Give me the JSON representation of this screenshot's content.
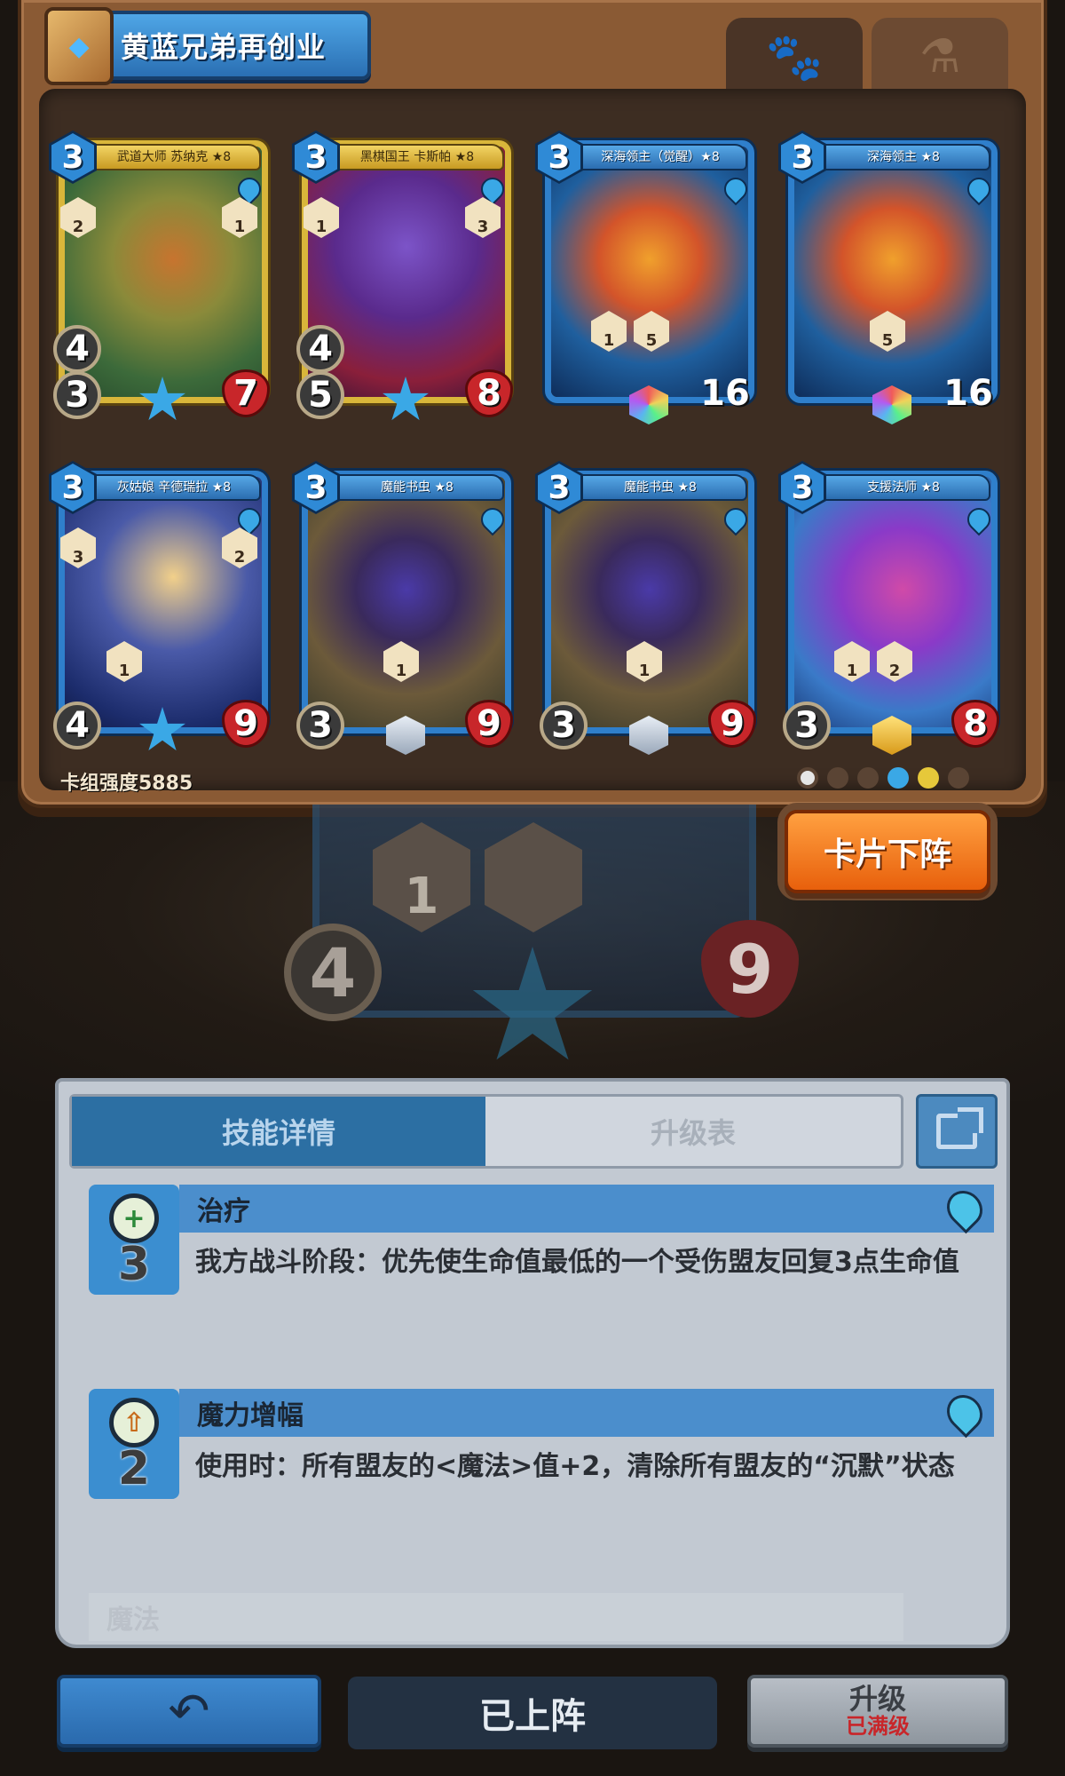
{
  "deck": {
    "title": "黄蓝兄弟再创业",
    "tabs": [
      {
        "icon": "paw-icon",
        "active": true
      },
      {
        "icon": "potion-icon",
        "active": false
      }
    ],
    "strength_label": "卡组强度5885",
    "filters": [
      "all",
      "beast",
      "fire",
      "water",
      "wind",
      "flame"
    ]
  },
  "cards": [
    {
      "name": "武道大师 苏纳克 ★8",
      "cost": "3",
      "atk": "3",
      "atk2": "4",
      "hp": "7",
      "skills": [
        "2",
        "1"
      ],
      "bottom_skill": "",
      "gem": "star",
      "frame": "gold",
      "art": "monk"
    },
    {
      "name": "黑棋国王 卡斯帕 ★8",
      "cost": "3",
      "atk": "5",
      "atk2": "4",
      "hp": "8",
      "skills": [
        "1",
        "3"
      ],
      "bottom_skill": "",
      "gem": "star",
      "frame": "gold",
      "art": "king"
    },
    {
      "name": "深海领主（觉醒）★8",
      "cost": "3",
      "atk": "",
      "atk2": "",
      "hp": "16",
      "skills": [
        "1",
        "5"
      ],
      "bottom_skill": "",
      "gem": "rainbow",
      "frame": "blue",
      "art": "kraken"
    },
    {
      "name": "深海领主 ★8",
      "cost": "3",
      "atk": "",
      "atk2": "",
      "hp": "16",
      "skills": [
        "5"
      ],
      "bottom_skill": "",
      "gem": "rainbow",
      "frame": "blue",
      "art": "kraken"
    },
    {
      "name": "灰姑娘 辛德瑞拉 ★8",
      "cost": "3",
      "atk": "4",
      "atk2": "",
      "hp": "9",
      "skills": [
        "3",
        "2",
        "1"
      ],
      "bottom_skill": "",
      "gem": "star",
      "frame": "blue",
      "art": "cinder"
    },
    {
      "name": "魔能书虫 ★8",
      "cost": "3",
      "atk": "3",
      "atk2": "",
      "hp": "9",
      "skills": [
        "1"
      ],
      "bottom_skill": "",
      "gem": "silver",
      "frame": "blue",
      "art": "worm"
    },
    {
      "name": "魔能书虫 ★8",
      "cost": "3",
      "atk": "3",
      "atk2": "",
      "hp": "9",
      "skills": [
        "1"
      ],
      "bottom_skill": "",
      "gem": "silver",
      "frame": "blue",
      "art": "worm"
    },
    {
      "name": "支援法师 ★8",
      "cost": "3",
      "atk": "3",
      "atk2": "",
      "hp": "8",
      "skills": [
        "1",
        "2"
      ],
      "bottom_skill": "",
      "gem": "gold",
      "frame": "blue",
      "art": "mage"
    }
  ],
  "preview": {
    "skill_1": "1",
    "atk": "4",
    "hp": "9"
  },
  "actions": {
    "unequip_label": "卡片下阵"
  },
  "skill_panel": {
    "tab_active": "技能详情",
    "tab_inactive": "升级表",
    "skills": [
      {
        "name": "治疗",
        "level": "3",
        "glyph": "+",
        "desc": "我方战斗阶段：优先使生命值最低的一个受伤盟友回复3点生命值"
      },
      {
        "name": "魔力增幅",
        "level": "2",
        "glyph": "⇧",
        "desc": "使用时：所有盟友的<魔法>值+2，清除所有盟友的“沉默”状态"
      },
      {
        "name": "魔法",
        "level": "",
        "glyph": "",
        "desc": ""
      }
    ]
  },
  "bottom": {
    "back_icon": "back-arrow-icon",
    "status": "已上阵",
    "upgrade": "升级",
    "upgrade_sub": "已满级"
  },
  "colors": {
    "panel_brown": "#8a5a34",
    "accent_blue": "#2f7fcb",
    "orange_button": "#f07a20",
    "maxed_red": "#c8262a"
  }
}
